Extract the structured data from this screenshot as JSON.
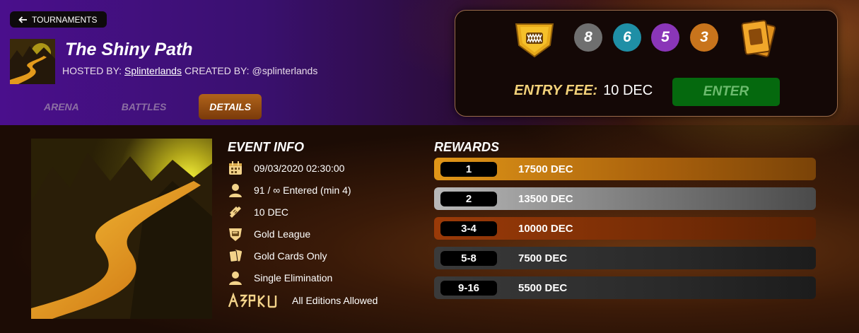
{
  "header": {
    "back_label": "TOURNAMENTS",
    "title": "The Shiny Path",
    "hosted_by_label": "HOSTED BY:",
    "host": "Splinterlands",
    "created_by_label": "CREATED BY:",
    "creator": "@splinterlands"
  },
  "tabs": [
    {
      "label": "ARENA"
    },
    {
      "label": "BATTLES"
    },
    {
      "label": "DETAILS"
    }
  ],
  "panel": {
    "mana_caps": [
      {
        "value": "8",
        "color": "#6f6f6f"
      },
      {
        "value": "6",
        "color": "#1f8fa6"
      },
      {
        "value": "5",
        "color": "#8a36b8"
      },
      {
        "value": "3",
        "color": "#c8741c"
      }
    ],
    "entry_fee_label": "ENTRY FEE:",
    "entry_fee_value": "10 DEC",
    "enter_label": "ENTER"
  },
  "event_info": {
    "title": "EVENT INFO",
    "rows": [
      {
        "icon": "calendar-icon",
        "text": "09/03/2020 02:30:00"
      },
      {
        "icon": "player-icon",
        "text": "91 / ∞ Entered (min 4)"
      },
      {
        "icon": "ticket-icon",
        "text": "10 DEC"
      },
      {
        "icon": "league-icon",
        "text": "Gold League"
      },
      {
        "icon": "cards-icon",
        "text": "Gold Cards Only"
      },
      {
        "icon": "player-icon",
        "text": "Single Elimination"
      },
      {
        "icon": "editions-icon",
        "text": "All Editions Allowed"
      }
    ]
  },
  "rewards": {
    "title": "REWARDS",
    "items": [
      {
        "rank": "1",
        "prize": "17500 DEC"
      },
      {
        "rank": "2",
        "prize": "13500 DEC"
      },
      {
        "rank": "3-4",
        "prize": "10000 DEC"
      },
      {
        "rank": "5-8",
        "prize": "7500 DEC"
      },
      {
        "rank": "9-16",
        "prize": "5500 DEC"
      }
    ]
  }
}
